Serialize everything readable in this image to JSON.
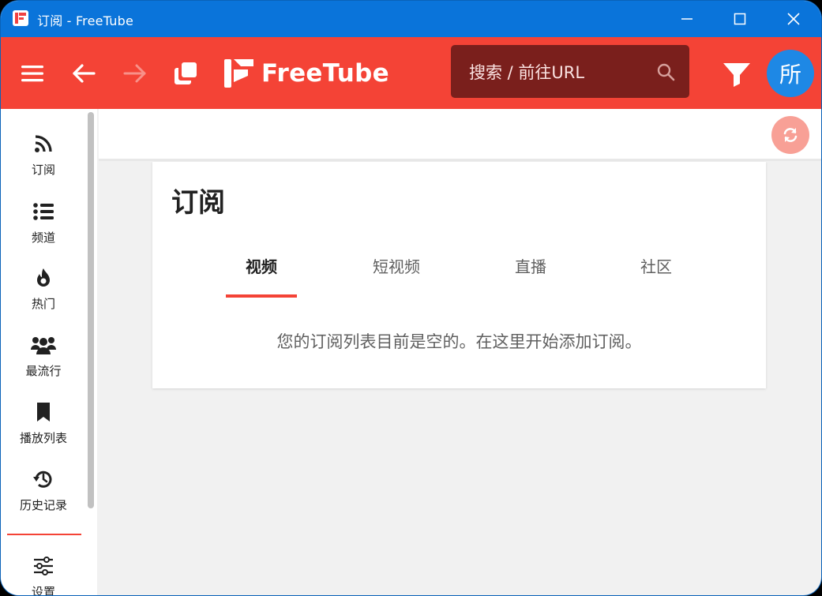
{
  "window": {
    "title": "订阅 - FreeTube"
  },
  "topnav": {
    "logo_text": "FreeTube",
    "search_placeholder": "搜索 / 前往URL",
    "avatar_letter": "所"
  },
  "sidebar": {
    "items": [
      {
        "label": "订阅",
        "icon": "rss-icon"
      },
      {
        "label": "频道",
        "icon": "list-icon"
      },
      {
        "label": "热门",
        "icon": "fire-icon"
      },
      {
        "label": "最流行",
        "icon": "users-icon"
      },
      {
        "label": "播放列表",
        "icon": "bookmark-icon"
      },
      {
        "label": "历史记录",
        "icon": "history-icon"
      },
      {
        "label": "设置",
        "icon": "sliders-icon"
      }
    ]
  },
  "main": {
    "title": "订阅",
    "tabs": [
      {
        "label": "视频",
        "active": true
      },
      {
        "label": "短视频",
        "active": false
      },
      {
        "label": "直播",
        "active": false
      },
      {
        "label": "社区",
        "active": false
      }
    ],
    "empty_message": "您的订阅列表目前是空的。在这里开始添加订阅。"
  },
  "colors": {
    "accent": "#f44336",
    "titlebar": "#0a74da",
    "search_bg": "#7a1f1c",
    "avatar": "#1e88e5"
  }
}
